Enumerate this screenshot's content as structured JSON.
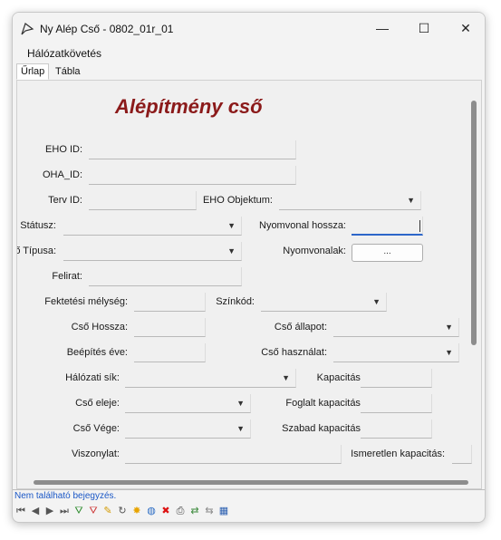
{
  "window": {
    "title": "Ny Alép Cső - 0802_01r_01",
    "minimize": "—",
    "maximize": "☐",
    "close": "✕"
  },
  "menu": {
    "item": "Hálózatkövetés"
  },
  "tabs": [
    {
      "label": "Űrlap"
    },
    {
      "label": "Tábla"
    }
  ],
  "form": {
    "title": "Alépítmény cső",
    "labels": {
      "eho_id": "EHO ID:",
      "oha_id": "OHA_ID:",
      "terv_id": "Terv ID:",
      "eho_objektum": "EHO Objektum:",
      "statusz": "Státusz:",
      "nyomvonal_hossza": "Nyomvonal hossza:",
      "cso_tipusa": "Cső Típusa:",
      "nyomvonalak": "Nyomvonalak:",
      "felirat": "Felirat:",
      "fektetesi_melyseg": "Fektetési mélység:",
      "szinkod": "Színkód:",
      "cso_hossza": "Cső Hossza:",
      "cso_allapot": "Cső állapot:",
      "beepites_eve": "Beépítés éve:",
      "cso_hasznalat": "Cső használat:",
      "halozati_sik": "Hálózati sík:",
      "kapacitas": "Kapacitás:",
      "cso_eleje": "Cső eleje:",
      "foglalt_kapacitas": "Foglalt kapacitás:",
      "cso_vege": "Cső Vége:",
      "szabad_kapacitas": "Szabad kapacitás:",
      "viszonylat": "Viszonylat:",
      "ismeretlen_kapacitas": "Ismeretlen kapacitás:"
    },
    "nyomvonalak_button": "..."
  },
  "status_text": "Nem található bejegyzés.",
  "toolbar_icons": [
    "first-record-icon",
    "prev-record-icon",
    "next-record-icon",
    "last-record-icon",
    "filter-add-icon",
    "filter-remove-icon",
    "edit-icon",
    "refresh-icon",
    "new-icon",
    "globe-icon",
    "delete-icon",
    "print-icon",
    "link-icon",
    "unlink-icon",
    "table-icon"
  ],
  "colors": {
    "title": "#8b1a1a",
    "status": "#1a57c6",
    "focus": "#2d66c9"
  }
}
